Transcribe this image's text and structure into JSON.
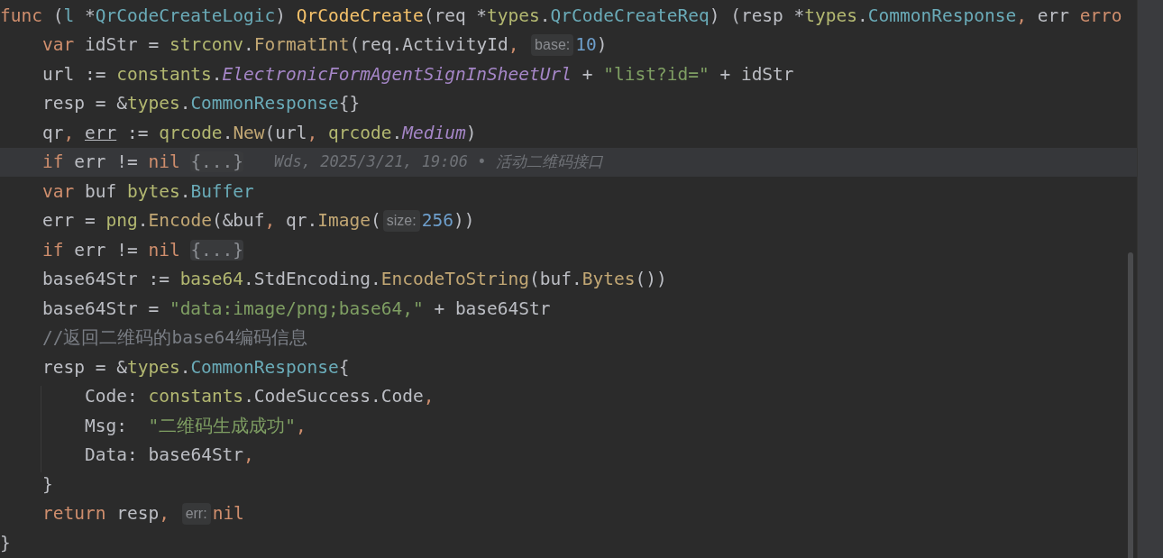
{
  "editor": {
    "lines": [
      {
        "current": false,
        "tokens": [
          {
            "kind": "kw",
            "text": "func"
          },
          {
            "kind": "p",
            "text": " ("
          },
          {
            "kind": "ty",
            "text": "l"
          },
          {
            "kind": "p",
            "text": " *"
          },
          {
            "kind": "ty",
            "text": "QrCodeCreateLogic"
          },
          {
            "kind": "p",
            "text": ") "
          },
          {
            "kind": "fn",
            "text": "QrCodeCreate"
          },
          {
            "kind": "p",
            "text": "(req *"
          },
          {
            "kind": "pk",
            "text": "types"
          },
          {
            "kind": "p",
            "text": "."
          },
          {
            "kind": "ty",
            "text": "QrCodeCreateReq"
          },
          {
            "kind": "p",
            "text": ") (resp *"
          },
          {
            "kind": "pk",
            "text": "types"
          },
          {
            "kind": "p",
            "text": "."
          },
          {
            "kind": "ty",
            "text": "CommonResponse"
          },
          {
            "kind": "o",
            "text": ","
          },
          {
            "kind": "p",
            "text": " err "
          },
          {
            "kind": "kw",
            "text": "erro"
          }
        ],
        "children": [
          {
            "current": false,
            "tokens": [
              {
                "kind": "kw",
                "text": "var"
              },
              {
                "kind": "p",
                "text": " idStr = "
              },
              {
                "kind": "pk",
                "text": "strconv"
              },
              {
                "kind": "p",
                "text": "."
              },
              {
                "kind": "call",
                "text": "FormatInt"
              },
              {
                "kind": "p",
                "text": "(req.ActivityId"
              },
              {
                "kind": "o",
                "text": ", "
              },
              {
                "kind": "h",
                "text": "base:"
              },
              {
                "kind": "n",
                "text": "10"
              },
              {
                "kind": "p",
                "text": ")"
              }
            ]
          },
          {
            "current": false,
            "tokens": [
              {
                "kind": "p",
                "text": "url := "
              },
              {
                "kind": "pk",
                "text": "constants"
              },
              {
                "kind": "p",
                "text": "."
              },
              {
                "kind": "c",
                "text": "ElectronicFormAgentSignInSheetUrl"
              },
              {
                "kind": "p",
                "text": " + "
              },
              {
                "kind": "s",
                "text": "\"list?id=\""
              },
              {
                "kind": "p",
                "text": " + idStr"
              }
            ]
          },
          {
            "current": false,
            "tokens": [
              {
                "kind": "p",
                "text": "resp = &"
              },
              {
                "kind": "pk",
                "text": "types"
              },
              {
                "kind": "p",
                "text": "."
              },
              {
                "kind": "ty",
                "text": "CommonResponse"
              },
              {
                "kind": "p",
                "text": "{}"
              }
            ]
          },
          {
            "current": false,
            "tokens": [
              {
                "kind": "p",
                "text": "qr"
              },
              {
                "kind": "o",
                "text": ", "
              },
              {
                "kind": "u",
                "text": "err"
              },
              {
                "kind": "p",
                "text": " := "
              },
              {
                "kind": "pk",
                "text": "qrcode"
              },
              {
                "kind": "p",
                "text": "."
              },
              {
                "kind": "call",
                "text": "New"
              },
              {
                "kind": "p",
                "text": "(url"
              },
              {
                "kind": "o",
                "text": ", "
              },
              {
                "kind": "pk",
                "text": "qrcode"
              },
              {
                "kind": "p",
                "text": "."
              },
              {
                "kind": "c",
                "text": "Medium"
              },
              {
                "kind": "p",
                "text": ")"
              }
            ]
          },
          {
            "current": true,
            "tokens": [
              {
                "kind": "kw",
                "text": "if"
              },
              {
                "kind": "p",
                "text": " err != "
              },
              {
                "kind": "kw",
                "text": "nil "
              },
              {
                "kind": "f",
                "text": "{...}"
              },
              {
                "kind": "blame",
                "text": "Wds, 2025/3/21, 19:06 • 活动二维码接口"
              }
            ]
          },
          {
            "current": false,
            "tokens": [
              {
                "kind": "kw",
                "text": "var"
              },
              {
                "kind": "p",
                "text": " buf "
              },
              {
                "kind": "pk",
                "text": "bytes"
              },
              {
                "kind": "p",
                "text": "."
              },
              {
                "kind": "ty",
                "text": "Buffer"
              }
            ]
          },
          {
            "current": false,
            "tokens": [
              {
                "kind": "p",
                "text": "err = "
              },
              {
                "kind": "pk",
                "text": "png"
              },
              {
                "kind": "p",
                "text": "."
              },
              {
                "kind": "call",
                "text": "Encode"
              },
              {
                "kind": "p",
                "text": "(&buf"
              },
              {
                "kind": "o",
                "text": ","
              },
              {
                "kind": "p",
                "text": " qr."
              },
              {
                "kind": "call",
                "text": "Image"
              },
              {
                "kind": "p",
                "text": "("
              },
              {
                "kind": "h",
                "text": "size:"
              },
              {
                "kind": "n",
                "text": "256"
              },
              {
                "kind": "p",
                "text": "))"
              }
            ]
          },
          {
            "current": false,
            "tokens": [
              {
                "kind": "kw",
                "text": "if"
              },
              {
                "kind": "p",
                "text": " err != "
              },
              {
                "kind": "kw",
                "text": "nil "
              },
              {
                "kind": "f",
                "text": "{...}"
              }
            ]
          },
          {
            "current": false,
            "tokens": [
              {
                "kind": "p",
                "text": "base64Str := "
              },
              {
                "kind": "pk",
                "text": "base64"
              },
              {
                "kind": "p",
                "text": ".StdEncoding."
              },
              {
                "kind": "call",
                "text": "EncodeToString"
              },
              {
                "kind": "p",
                "text": "(buf."
              },
              {
                "kind": "call",
                "text": "Bytes"
              },
              {
                "kind": "p",
                "text": "())"
              }
            ]
          },
          {
            "current": false,
            "tokens": [
              {
                "kind": "p",
                "text": "base64Str = "
              },
              {
                "kind": "s",
                "text": "\"data:image/png;base64,\""
              },
              {
                "kind": "p",
                "text": " + base64Str"
              }
            ]
          },
          {
            "current": false,
            "tokens": [
              {
                "kind": "cm",
                "text": "//返回二维码的base64编码信息"
              }
            ]
          },
          {
            "current": false,
            "tokens": [
              {
                "kind": "p",
                "text": "resp = &"
              },
              {
                "kind": "pk",
                "text": "types"
              },
              {
                "kind": "p",
                "text": "."
              },
              {
                "kind": "ty",
                "text": "CommonResponse"
              },
              {
                "kind": "p",
                "text": "{"
              }
            ],
            "children": [
              {
                "current": false,
                "tokens": [
                  {
                    "kind": "p",
                    "text": "Code: "
                  },
                  {
                    "kind": "pk",
                    "text": "constants"
                  },
                  {
                    "kind": "p",
                    "text": ".CodeSuccess.Code"
                  },
                  {
                    "kind": "o",
                    "text": ","
                  }
                ]
              },
              {
                "current": false,
                "tokens": [
                  {
                    "kind": "p",
                    "text": "Msg:  "
                  },
                  {
                    "kind": "s",
                    "text": "\"二维码生成成功\""
                  },
                  {
                    "kind": "o",
                    "text": ","
                  }
                ]
              },
              {
                "current": false,
                "tokens": [
                  {
                    "kind": "p",
                    "text": "Data: base64Str"
                  },
                  {
                    "kind": "o",
                    "text": ","
                  }
                ]
              }
            ]
          },
          {
            "current": false,
            "tokens": [
              {
                "kind": "p",
                "text": "}"
              }
            ]
          },
          {
            "current": false,
            "tokens": [
              {
                "kind": "kw",
                "text": "return"
              },
              {
                "kind": "p",
                "text": " resp"
              },
              {
                "kind": "o",
                "text": ", "
              },
              {
                "kind": "h",
                "text": "err:"
              },
              {
                "kind": "kw",
                "text": "nil"
              }
            ]
          }
        ]
      },
      {
        "current": false,
        "tokens": [
          {
            "kind": "p",
            "text": "}"
          }
        ]
      }
    ]
  }
}
